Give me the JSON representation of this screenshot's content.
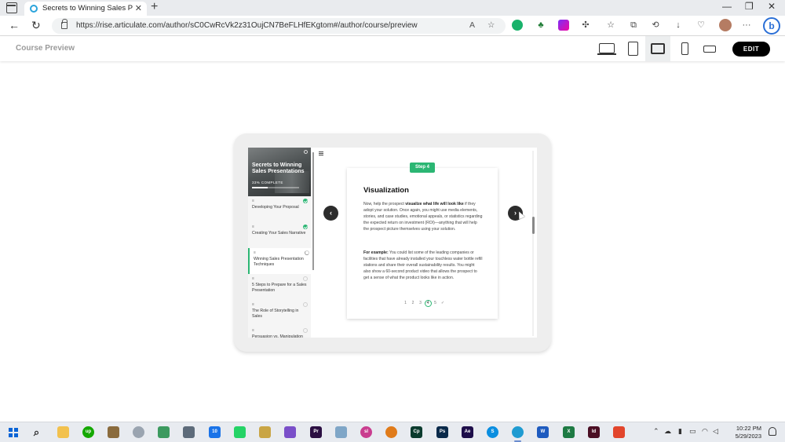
{
  "browser": {
    "tab_title": "Secrets to Winning Sales Presentations",
    "url": "https://rise.articulate.com/author/sC0CwRcVk2z31OujCN7BeFLHfEKgtom#/author/course/preview",
    "new_tab": "+",
    "tab_close": "✕",
    "window_minimize": "—",
    "window_restore": "❐",
    "window_close": "✕",
    "back": "←",
    "reload": "↻",
    "read_aloud": "A",
    "favorite": "☆",
    "collections": "☆",
    "history": "⟲",
    "downloads": "↓",
    "more": "···",
    "bing": "b"
  },
  "app": {
    "header_title": "Course Preview",
    "edit_label": "EDIT"
  },
  "course": {
    "title": "Secrets to Winning Sales Presentations",
    "progress_text": "33% COMPLETE",
    "progress": 0.33,
    "lessons": [
      {
        "marker": "≡",
        "label": "Developing Your Proposal",
        "status": "complete"
      },
      {
        "marker": "≡",
        "label": "Creating Your Sales Narrative",
        "status": "complete"
      },
      {
        "marker": "≡",
        "label": "Winning Sales Presentation Techniques",
        "status": "in-progress"
      },
      {
        "marker": "≡",
        "label": "5 Steps to Prepare for a Sales Presentation",
        "status": "not-started"
      },
      {
        "marker": "≡",
        "label": "The Role of Storytelling in Sales",
        "status": "not-started"
      },
      {
        "marker": "≡",
        "label": "Persuasion vs. Manipulation",
        "status": "not-started"
      }
    ]
  },
  "slide": {
    "step_badge": "Step 4",
    "heading": "Visualization",
    "p1_a": "Now, help the prospect ",
    "p1_b": "visualize what life will look like",
    "p1_c": " if they adopt your solution. Once again, you might use media elements, stories, and case studies, emotional appeals, or statistics regarding the expected return on investment (ROI)—anything that will help the prospect picture themselves using your solution.",
    "p2_a": "For example:",
    "p2_b": " You could list some of the leading companies or facilities that have already installed your touchless water bottle refill stations and share their overall sustainability results. You might also show a 60-second product video that allows the prospect to get a sense of what the product looks like in action.",
    "pages": [
      "1",
      "2",
      "3",
      "4",
      "5",
      "✓"
    ],
    "current_page": 4,
    "prev": "‹",
    "next": "›"
  },
  "taskbar": {
    "time": "10:22 PM",
    "date": "5/29/2023",
    "notification_count": "10",
    "apps": [
      {
        "name": "file-explorer",
        "label": "",
        "color": "#f2c14e"
      },
      {
        "name": "upwork",
        "label": "up",
        "color": "#14a800"
      },
      {
        "name": "app-tree",
        "label": "",
        "color": "#8a6b3d"
      },
      {
        "name": "app-disk",
        "label": "",
        "color": "#9aa4b0"
      },
      {
        "name": "app-green",
        "label": "",
        "color": "#3c9a5f"
      },
      {
        "name": "calculator",
        "label": "",
        "color": "#5d6b7a"
      },
      {
        "name": "mail",
        "label": "10",
        "color": "#1a73e8"
      },
      {
        "name": "whatsapp",
        "label": "",
        "color": "#25d366"
      },
      {
        "name": "app-notes",
        "label": "",
        "color": "#c9a545"
      },
      {
        "name": "app-folder",
        "label": "",
        "color": "#7a4fc9"
      },
      {
        "name": "premiere",
        "label": "Pr",
        "color": "#2b0f42"
      },
      {
        "name": "app-book",
        "label": "",
        "color": "#7fa6c7"
      },
      {
        "name": "slack",
        "label": "sl",
        "color": "#c93d8f"
      },
      {
        "name": "app-globe",
        "label": "",
        "color": "#e07b1a"
      },
      {
        "name": "character-animator",
        "label": "Cp",
        "color": "#0b3b2e"
      },
      {
        "name": "photoshop",
        "label": "Ps",
        "color": "#0a2a4a"
      },
      {
        "name": "after-effects",
        "label": "Ae",
        "color": "#1e0e4a"
      },
      {
        "name": "skype",
        "label": "S",
        "color": "#0a8ee0"
      },
      {
        "name": "edge",
        "label": "",
        "color": "#1f9bd1"
      },
      {
        "name": "word",
        "label": "W",
        "color": "#1e5bbf"
      },
      {
        "name": "excel",
        "label": "X",
        "color": "#1d7a43"
      },
      {
        "name": "indesign",
        "label": "Id",
        "color": "#4a0e23"
      },
      {
        "name": "app-red",
        "label": "",
        "color": "#e2452c"
      }
    ]
  }
}
